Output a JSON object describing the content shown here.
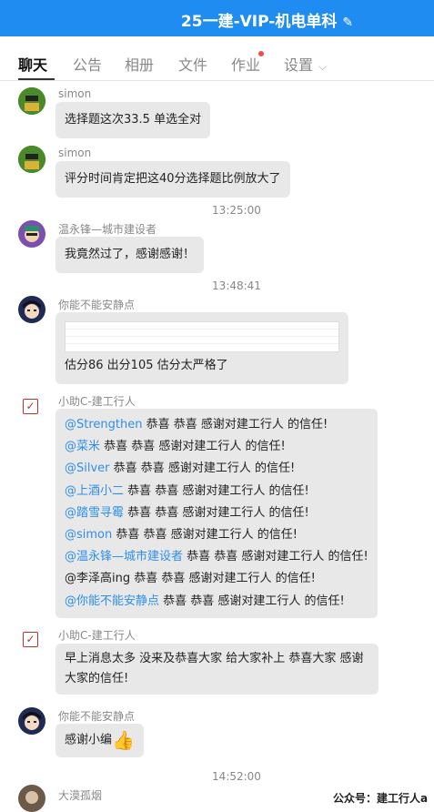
{
  "header": {
    "title": "25一建-VIP-机电单科"
  },
  "tabs": [
    "聊天",
    "公告",
    "相册",
    "文件",
    "作业",
    "设置"
  ],
  "messages": [
    {
      "sender": "simon",
      "text": "选择题这次33.5  单选全对"
    },
    {
      "sender": "simon",
      "text": "评分时间肯定把这40分选择题比例放大了"
    },
    {
      "time": "13:25:00"
    },
    {
      "sender": "温永锋—城市建设者",
      "text": "我竟然过了，感谢感谢！"
    },
    {
      "time": "13:48:41"
    },
    {
      "sender": "你能不能安静点",
      "text": "估分86 出分105  估分太严格了"
    },
    {
      "sender": "小助C-建工行人",
      "lines": [
        {
          "mention": "@Strengthen",
          "rest": " 恭喜 恭喜 感谢对建工行人 的信任!"
        },
        {
          "mention": "@菜米",
          "rest": " 恭喜 恭喜 感谢对建工行人  的信任!"
        },
        {
          "mention": "@Silver",
          "rest": "  恭喜 恭喜 感谢对建工行人  的信任!"
        },
        {
          "mention": "@上酒小二",
          "rest": " 恭喜 恭喜 感谢对建工行人  的信任!"
        },
        {
          "mention": "@踏雪寻霉",
          "rest": " 恭喜 恭喜 感谢对建工行人  的信任!"
        },
        {
          "mention": "@simon",
          "rest": " 恭喜 恭喜 感谢对建工行人  的信任!"
        },
        {
          "mention": "@温永锋—城市建设者",
          "rest": " 恭喜 恭喜 感谢对建工行人  的信任!"
        },
        {
          "mention": "",
          "rest": "@李泽高ing  恭喜 恭喜 感谢对建工行人  的信任!"
        },
        {
          "mention": "@你能不能安静点",
          "rest": " 恭喜 恭喜 感谢对建工行人  的信任!"
        }
      ]
    },
    {
      "sender": "小助C-建工行人",
      "text": "早上消息太多 没来及恭喜大家 给大家补上  恭喜大家  感谢大家的信任!"
    },
    {
      "sender": "你能不能安静点",
      "text": "感谢小编"
    },
    {
      "time": "14:52:00"
    },
    {
      "sender": "大漠孤烟"
    }
  ],
  "watermark": "公众号：建工行人a",
  "colors": {
    "header": "#1e8cf0",
    "mention": "#2f8fe8",
    "bubble": "#e8e8e8"
  }
}
